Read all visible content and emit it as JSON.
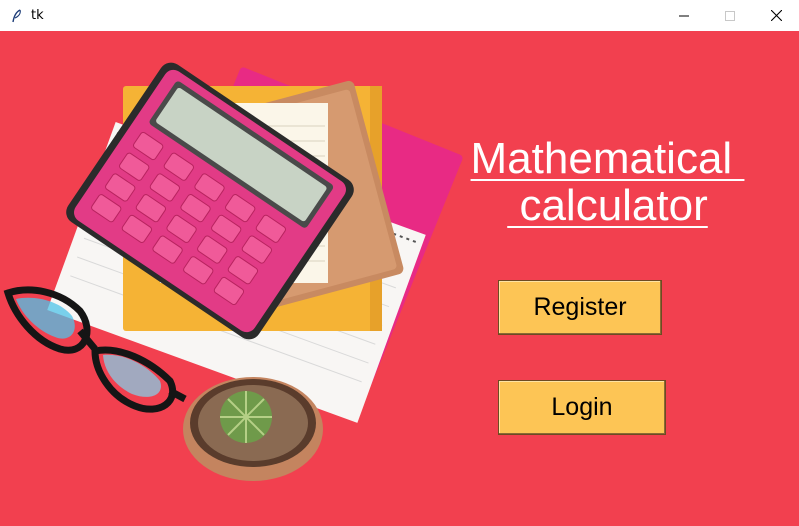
{
  "window": {
    "title": "tk",
    "icon": "feather-icon",
    "controls": [
      "minimize-icon",
      "maximize-icon",
      "close-icon"
    ]
  },
  "main": {
    "heading_line1": "Mathematical ",
    "heading_line2": " calculator",
    "register_label": "Register",
    "login_label": "Login",
    "background_image": "calculator-notebooks-glasses-cactus-photo"
  },
  "colors": {
    "background": "#f2404f",
    "button": "#fdc555",
    "heading": "#ffffff",
    "calculator": "#e23b86",
    "folder": "#f5b335"
  }
}
